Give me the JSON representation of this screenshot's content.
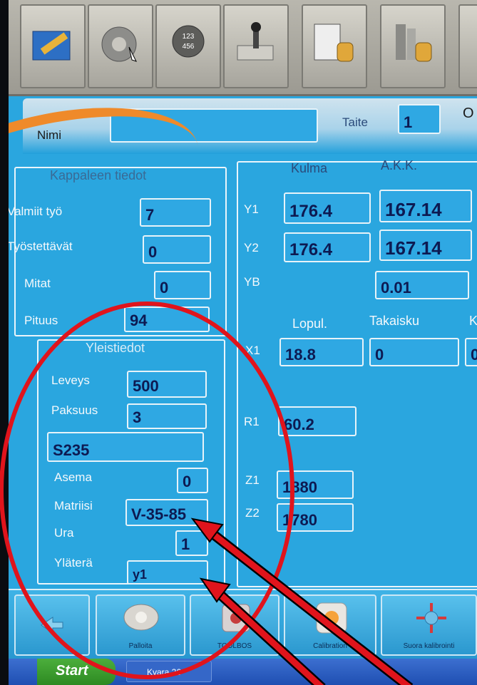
{
  "header": {
    "name_label": "Nimi",
    "name_value": "",
    "bend_label": "Taite",
    "bend_value": "1",
    "cut_label": "O"
  },
  "part_info": {
    "title": "Kappaleen tiedot",
    "rows": [
      {
        "label": "Valmiit työ",
        "value": "7"
      },
      {
        "label": "Työstettävät",
        "value": "0"
      },
      {
        "label": "Mitat",
        "value": "0"
      },
      {
        "label": "Pituus",
        "value": "94"
      }
    ]
  },
  "general_info": {
    "title": "Yleistiedot",
    "width_label": "Leveys",
    "width_value": "500",
    "thickness_label": "Paksuus",
    "thickness_value": "3",
    "material_value": "S235",
    "station_label": "Asema",
    "station_value": "0",
    "die_label": "Matriisi",
    "die_value": "V-35-85",
    "groove_label": "Ura",
    "groove_value": "1",
    "punch_label": "Yläterä",
    "punch_value": "y1"
  },
  "axes": {
    "col_angle": "Kulma",
    "col_akk": "A.K.K.",
    "y1_label": "Y1",
    "y1_angle": "176.4",
    "y1_akk": "167.14",
    "y2_label": "Y2",
    "y2_angle": "176.4",
    "y2_akk": "167.14",
    "yb_label": "YB",
    "yb_akk": "0.01",
    "col_final": "Lopul.",
    "col_springback": "Takaisku",
    "col_k": "K",
    "x1_label": "X1",
    "x1_final": "18.8",
    "x1_springback": "0",
    "x1_k": "0",
    "r1_label": "R1",
    "r1_value": "60.2",
    "z1_label": "Z1",
    "z1_value": "1880",
    "z2_label": "Z2",
    "z2_value": "1780"
  },
  "bottom_buttons": {
    "palloita": "Palloita",
    "toolbos": "TOOLBOS",
    "calibration": "Calibration",
    "suora": "Suora kalibrointi"
  },
  "taskbar": {
    "start": "Start",
    "task": "Kvara 26"
  },
  "colors": {
    "screen": "#2aa6df",
    "annotation_red": "#e0141c",
    "field_text": "#0d1a52"
  }
}
